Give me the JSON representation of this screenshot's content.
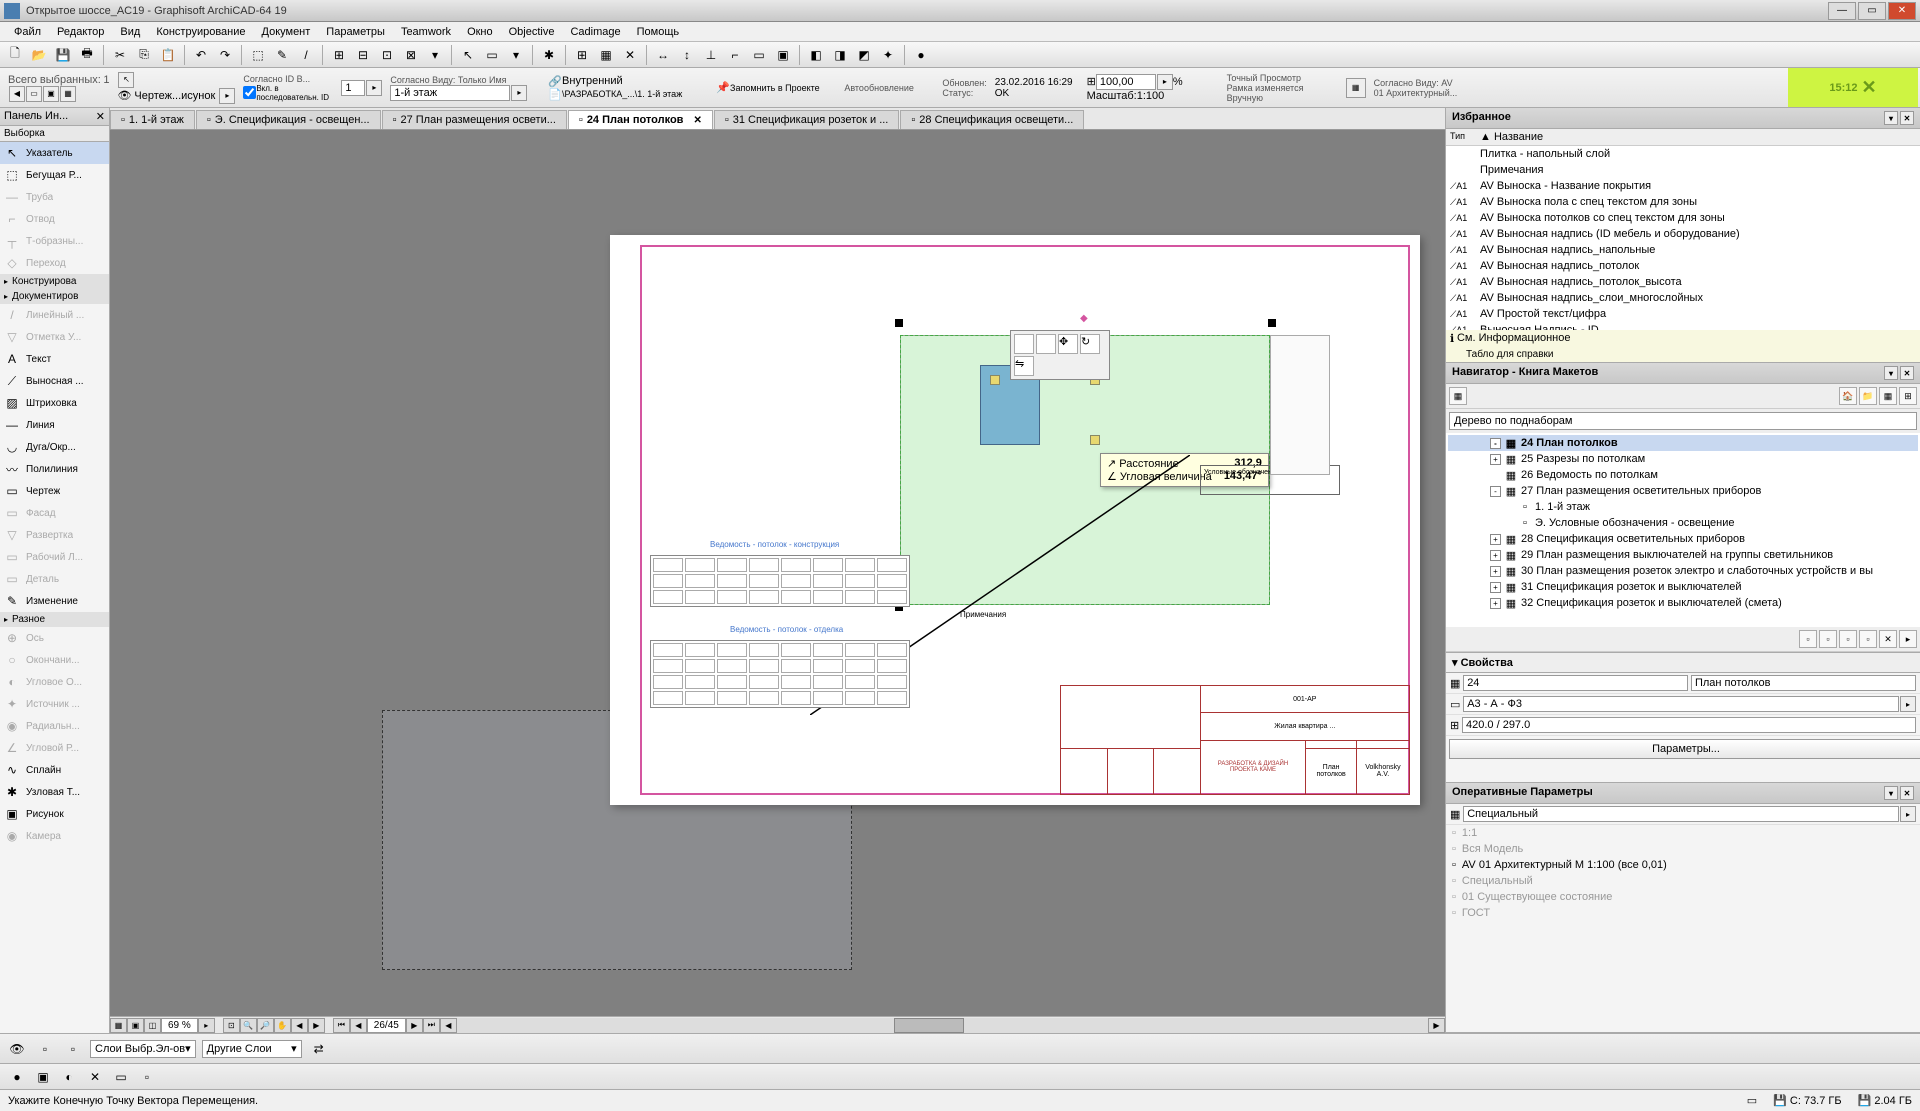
{
  "title": "Открытое шоссе_AC19 - Graphisoft ArchiCAD-64 19",
  "menu": [
    "Файл",
    "Редактор",
    "Вид",
    "Конструирование",
    "Документ",
    "Параметры",
    "Teamwork",
    "Окно",
    "Objective",
    "Cadimage",
    "Помощь"
  ],
  "toolbox": {
    "panel_title": "Панель Ин...",
    "subtitle": "Выборка",
    "items": [
      {
        "icon": "↖",
        "label": "Указатель",
        "sel": true
      },
      {
        "icon": "⬚",
        "label": "Бегущая Р..."
      },
      {
        "icon": "—",
        "label": "Труба",
        "dis": true
      },
      {
        "icon": "⌐",
        "label": "Отвод",
        "dis": true
      },
      {
        "icon": "┬",
        "label": "Т-образны...",
        "dis": true
      },
      {
        "icon": "◇",
        "label": "Переход",
        "dis": true
      }
    ],
    "hdr1": "Конструирова",
    "hdr2": "Документиров",
    "items2": [
      {
        "icon": "/",
        "label": "Линейный ...",
        "dis": true
      },
      {
        "icon": "▽",
        "label": "Отметка У...",
        "dis": true
      },
      {
        "icon": "A",
        "label": "Текст"
      },
      {
        "icon": "⟋",
        "label": "Выносная ..."
      },
      {
        "icon": "▨",
        "label": "Штриховка"
      },
      {
        "icon": "—",
        "label": "Линия"
      },
      {
        "icon": "◡",
        "label": "Дуга/Окр..."
      },
      {
        "icon": "〰",
        "label": "Полилиния"
      },
      {
        "icon": "▭",
        "label": "Чертеж"
      },
      {
        "icon": "▭",
        "label": "Фасад",
        "dis": true
      },
      {
        "icon": "▽",
        "label": "Развертка",
        "dis": true
      },
      {
        "icon": "▭",
        "label": "Рабочий Л...",
        "dis": true
      },
      {
        "icon": "▭",
        "label": "Деталь",
        "dis": true
      },
      {
        "icon": "✎",
        "label": "Изменение"
      }
    ],
    "hdr3": "Разное",
    "items3": [
      {
        "icon": "⊕",
        "label": "Ось",
        "dis": true
      },
      {
        "icon": "○",
        "label": "Окончани...",
        "dis": true
      },
      {
        "icon": "◐",
        "label": "Угловое О...",
        "dis": true
      },
      {
        "icon": "✦",
        "label": "Источник ...",
        "dis": true
      },
      {
        "icon": "◉",
        "label": "Радиальн...",
        "dis": true
      },
      {
        "icon": "∠",
        "label": "Угловой Р...",
        "dis": true
      },
      {
        "icon": "∿",
        "label": "Сплайн"
      },
      {
        "icon": "✱",
        "label": "Узловая Т..."
      },
      {
        "icon": "▣",
        "label": "Рисунок"
      },
      {
        "icon": "◉",
        "label": "Камера",
        "dis": true
      }
    ]
  },
  "tabs": [
    {
      "label": "1. 1-й этаж"
    },
    {
      "label": "Э. Спецификация - освещен..."
    },
    {
      "label": "27 План размещения освети..."
    },
    {
      "label": "24 План потолков",
      "active": true
    },
    {
      "label": "31 Спецификация розеток и ..."
    },
    {
      "label": "28 Спецификация освещети..."
    }
  ],
  "info": {
    "selected_label": "Всего выбранных:",
    "selected_count": "1",
    "draw_label": "Чертеж...исунок",
    "id_order_label": "Согласно ID В...",
    "id_num": "1",
    "seq_label": "Вкл. в последовательн. ID",
    "view_label": "Согласно Виду: Только Имя",
    "floor": "1-й этаж",
    "internal": "Внутренний",
    "dev_path": "\\РАЗРАБОТКА_...\\1. 1-й этаж",
    "anchor": "Запомнить в Проекте",
    "auto_update": "Автообновление",
    "changed_label": "Обновлен:",
    "changed_val": "23.02.2016 16:29",
    "status_label": "Статус:",
    "status_val": "OK",
    "scale_num": "100,00",
    "scale_pct": "%",
    "scale_label": "Масштаб:",
    "scale_val": "1:100",
    "preview_label": "Точный Просмотр",
    "frame_label": "Рамка изменяется Вручную",
    "view_av": "Согласно Виду: AV",
    "arch": "01 Архитектурный...",
    "clock": "15:12"
  },
  "tooltip": {
    "dist_label": "Расстояние",
    "dist_val": "312,9",
    "ang_label": "Угловая величина",
    "ang_val": "143,47°"
  },
  "canvas_text": {
    "link1": "Ведомость - потолок - конструкция",
    "link2": "Ведомость - потолок - отделка",
    "legend": "Условные обозначения",
    "note": "Примечания"
  },
  "title_block": {
    "code": "001-АР",
    "proj": "Жилая квартира ...",
    "devby": "РАЗРАБОТКА & ДИЗАЙН ПРОЕКТА КАМЕ",
    "sheet_name": "План потолков",
    "author": "Volkhonsky A.V."
  },
  "zoom": {
    "pct": "69 %",
    "coord": "26/45"
  },
  "favorites": {
    "title": "Избранное",
    "col_type": "Тип",
    "col_name": "▲ Название",
    "items": [
      {
        "t": "",
        "n": "Плитка - напольный слой"
      },
      {
        "t": "",
        "n": "Примечания"
      },
      {
        "t": "⟋A1",
        "n": "AV Выноска - Название покрытия"
      },
      {
        "t": "⟋A1",
        "n": "AV Выноска пола с спец текстом для зоны"
      },
      {
        "t": "⟋A1",
        "n": "AV Выноска потолков со спец текстом для зоны"
      },
      {
        "t": "⟋A1",
        "n": "AV Выносная надпись (ID мебель и оборудование)"
      },
      {
        "t": "⟋A1",
        "n": "AV Выносная надпись_напольные"
      },
      {
        "t": "⟋A1",
        "n": "AV Выносная надпись_потолок"
      },
      {
        "t": "⟋A1",
        "n": "AV Выносная надпись_потолок_высота"
      },
      {
        "t": "⟋A1",
        "n": "AV Выносная надпись_слои_многослойных"
      },
      {
        "t": "⟋A1",
        "n": "AV Простой текст/цифра"
      },
      {
        "t": "⟋A1",
        "n": "Выносная Надпись - ID"
      }
    ],
    "info1": "См. Информационное",
    "info2": "Табло для справки"
  },
  "navigator": {
    "title": "Навигатор - Книга Макетов",
    "search_ph": "Дерево по поднаборам",
    "tree": [
      {
        "ind": 3,
        "tg": "-",
        "ic": "▦",
        "label": "24 План потолков",
        "sel": true
      },
      {
        "ind": 3,
        "tg": "+",
        "ic": "▦",
        "label": "25 Разрезы по потолкам"
      },
      {
        "ind": 3,
        "tg": "",
        "ic": "▦",
        "label": "26 Ведомость по потолкам"
      },
      {
        "ind": 3,
        "tg": "-",
        "ic": "▦",
        "label": "27 План размещения осветительных приборов"
      },
      {
        "ind": 4,
        "tg": "",
        "ic": "▫",
        "label": "1. 1-й этаж"
      },
      {
        "ind": 4,
        "tg": "",
        "ic": "▫",
        "label": "Э. Условные обозначения - освещение"
      },
      {
        "ind": 3,
        "tg": "+",
        "ic": "▦",
        "label": "28 Спецификация осветительных приборов"
      },
      {
        "ind": 3,
        "tg": "+",
        "ic": "▦",
        "label": "29 План размещения выключателей на группы светильников"
      },
      {
        "ind": 3,
        "tg": "+",
        "ic": "▦",
        "label": "30 План размещения розеток электро и слаботочных устройств и вы"
      },
      {
        "ind": 3,
        "tg": "+",
        "ic": "▦",
        "label": "31 Спецификация розеток и выключателей"
      },
      {
        "ind": 3,
        "tg": "+",
        "ic": "▦",
        "label": "32 Спецификация розеток и выключателей (смета)"
      }
    ]
  },
  "props": {
    "title": "Свойства",
    "id": "24",
    "name": "План потолков",
    "format": "A3 - А - Ф3",
    "size": "420.0 / 297.0",
    "btn": "Параметры..."
  },
  "opparams": {
    "title": "Оперативные Параметры",
    "special": "Специальный",
    "items": [
      {
        "l": "1:1",
        "d": true
      },
      {
        "l": "Вся Модель",
        "d": true
      },
      {
        "l": "AV 01 Архитектурный М 1:100 (все 0,01)",
        "d": false
      },
      {
        "l": "Специальный",
        "d": true
      },
      {
        "l": "01 Существующее состояние",
        "d": true
      },
      {
        "l": "ГОСТ",
        "d": true
      }
    ]
  },
  "layers": {
    "l1": "Слои Выбр.Эл-ов",
    "l2": "Другие Слои"
  },
  "status": {
    "hint": "Укажите Конечную Точку Вектора Перемещения.",
    "disk_c": "C: 73.7 ГБ",
    "disk_d": "2.04 ГБ"
  }
}
